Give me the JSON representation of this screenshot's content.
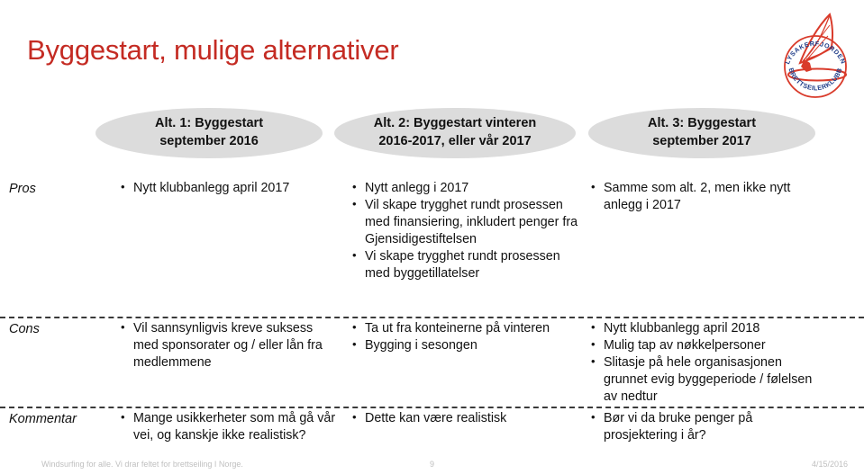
{
  "slide": {
    "title": "Byggestart, mulige alternativer"
  },
  "logo": {
    "name": "lysakerfjorden-brettseilerklubb-logo",
    "top_text": "LYSAKERFJORDEN",
    "bottom_text": "BRETTSEILERKLUBB",
    "sail_color": "#D93B2B",
    "text_color": "#1F3C88"
  },
  "columns": [
    {
      "label": "Alt. 1: Byggestart\nseptember 2016"
    },
    {
      "label": "Alt. 2: Byggestart vinteren\n2016-2017, eller vår 2017"
    },
    {
      "label": "Alt. 3: Byggestart\nseptember 2017"
    }
  ],
  "column_labels": {
    "c1_line1": "Alt. 1: Byggestart",
    "c1_line2": "september 2016",
    "c2_line1": "Alt. 2: Byggestart vinteren",
    "c2_line2": "2016-2017, eller vår 2017",
    "c3_line1": "Alt. 3: Byggestart",
    "c3_line2": "september 2017"
  },
  "rows": {
    "pros": {
      "label": "Pros",
      "col1": [
        "Nytt klubbanlegg april 2017"
      ],
      "col2": [
        "Nytt anlegg i 2017",
        "Vil skape trygghet rundt prosessen med finansiering, inkludert penger fra Gjensidigestiftelsen",
        "Vi skape trygghet rundt prosessen med byggetillatelser"
      ],
      "col3": [
        "Samme som alt. 2, men ikke nytt anlegg i 2017"
      ]
    },
    "cons": {
      "label": "Cons",
      "col1": [
        "Vil sannsynligvis kreve suksess med sponsorater og / eller lån fra medlemmene"
      ],
      "col2": [
        "Ta ut fra konteinerne på vinteren",
        "Bygging i sesongen"
      ],
      "col3": [
        "Nytt klubbanlegg april 2018",
        "Mulig tap av nøkkelpersoner",
        "Slitasje på hele organisasjonen grunnet evig byggeperiode / følelsen av nedtur"
      ]
    },
    "kommentar": {
      "label": "Kommentar",
      "col1": [
        "Mange usikkerheter som må gå vår vei, og kanskje ikke realistisk?"
      ],
      "col2": [
        "Dette kan være realistisk"
      ],
      "col3": [
        "Bør vi da bruke penger på prosjektering i år?"
      ]
    }
  },
  "footer": {
    "left": "Windsurfing for alle.  Vi drar feltet for brettseiling I Norge.",
    "page_number": "9",
    "date": "4/15/2016"
  },
  "colors": {
    "title": "#C42B23",
    "pill_bg": "#DCDCDC",
    "text": "#111111",
    "footer": "#BFBFBF"
  }
}
